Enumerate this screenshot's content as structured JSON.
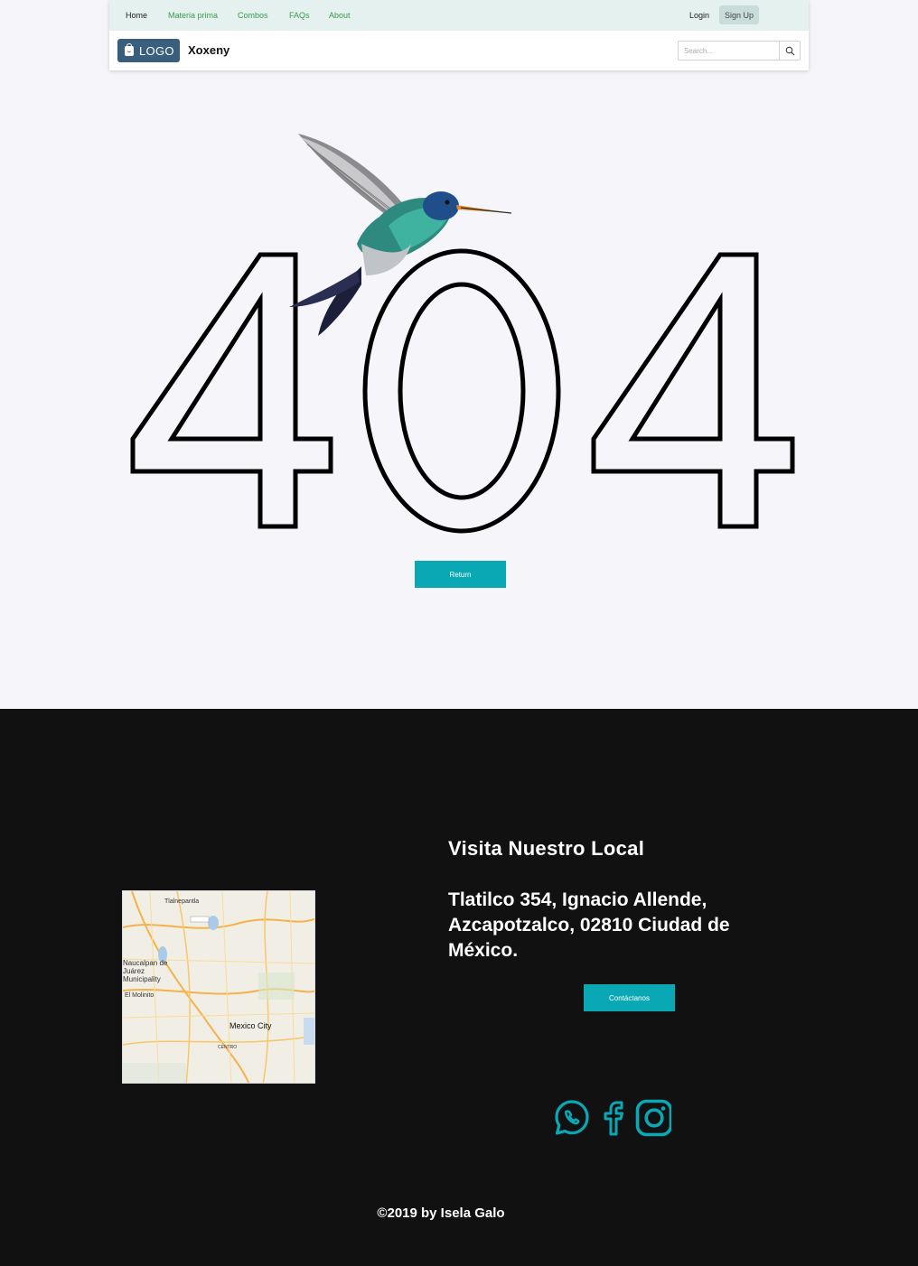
{
  "nav": {
    "items": [
      {
        "label": "Home"
      },
      {
        "label": "Materia prima"
      },
      {
        "label": "Combos"
      },
      {
        "label": "FAQs"
      },
      {
        "label": "About"
      }
    ],
    "login": "Login",
    "signup": "Sign Up"
  },
  "brand": {
    "logo": "LOGO",
    "name": "Xoxeny"
  },
  "search": {
    "placeholder": "Search..."
  },
  "error": {
    "code": "404",
    "return_label": "Return"
  },
  "footer": {
    "visit_title": "Visita Nuestro Local",
    "address": "Tlatilco 354, Ignacio Allende, Azcapotzalco, 02810 Ciudad de México.",
    "contact_label": "Contáctanos",
    "map_labels": {
      "tlalnepantla": "Tlalnepantla",
      "naucalpan": "Naucalpan de Juárez Municipality",
      "mexico_city": "Mexico City",
      "colonia_centro": "CENTRO",
      "el_molinito": "El Molinito"
    },
    "social": [
      "whatsapp-icon",
      "facebook-icon",
      "instagram-icon"
    ],
    "copyright": "©2019 by Isela Galo"
  },
  "colors": {
    "accent": "#0aa8b4",
    "nav_bg": "#e4f1ef",
    "logo_bg": "#3a5f7d",
    "footer_bg": "#111111"
  }
}
